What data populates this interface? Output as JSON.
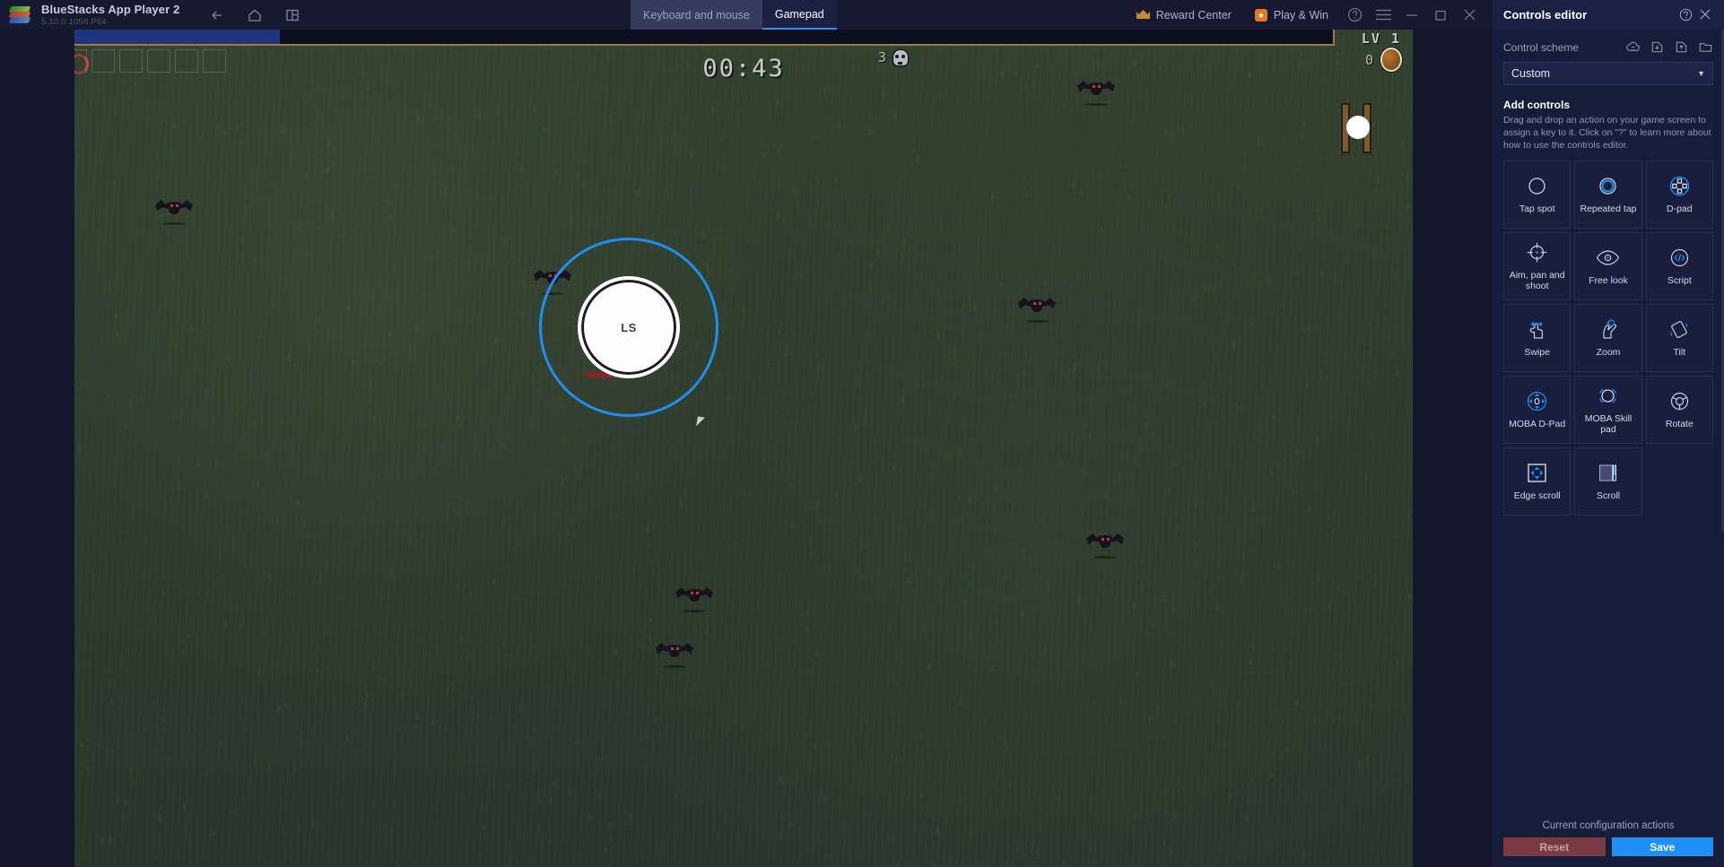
{
  "titlebar": {
    "app_name": "BlueStacks App Player 2",
    "app_version": "5.10.0.1058  P64",
    "nav": [
      {
        "name": "back-icon",
        "label": "Back"
      },
      {
        "name": "home-icon",
        "label": "Home"
      },
      {
        "name": "multi-instance-icon",
        "label": "Multi-instance"
      }
    ],
    "tabs": [
      {
        "label": "Keyboard and mouse",
        "active": false
      },
      {
        "label": "Gamepad",
        "active": true
      }
    ],
    "reward_center": "Reward Center",
    "play_and_win": "Play & Win",
    "window_controls": [
      "help-icon",
      "menu-icon",
      "minimize-icon",
      "maximize-icon",
      "close-icon"
    ]
  },
  "game": {
    "level_label": "LV 1",
    "xp_percent": 17,
    "timer": "00:43",
    "kill_count": "3",
    "coin_count": "0",
    "joystick_label": "LS",
    "item_slots": 6,
    "filled_slots": 1
  },
  "panel": {
    "title": "Controls editor",
    "help_icon": "help-icon",
    "close_icon": "close-icon",
    "scheme_label": "Control scheme",
    "scheme_icons": [
      {
        "name": "cloud-sync-icon"
      },
      {
        "name": "import-scheme-icon"
      },
      {
        "name": "export-scheme-icon"
      },
      {
        "name": "open-folder-icon"
      }
    ],
    "scheme_value": "Custom",
    "add_controls_title": "Add controls",
    "add_controls_desc": "Drag and drop an action on your game screen to assign a key to it. Click on \"?\" to learn more about how to use the controls editor.",
    "controls": [
      {
        "label": "Tap spot",
        "icon": "tap-spot-icon"
      },
      {
        "label": "Repeated tap",
        "icon": "repeated-tap-icon"
      },
      {
        "label": "D-pad",
        "icon": "d-pad-icon"
      },
      {
        "label": "Aim, pan and shoot",
        "icon": "aim-pan-shoot-icon"
      },
      {
        "label": "Free look",
        "icon": "free-look-icon"
      },
      {
        "label": "Script",
        "icon": "script-icon"
      },
      {
        "label": "Swipe",
        "icon": "swipe-icon"
      },
      {
        "label": "Zoom",
        "icon": "zoom-icon"
      },
      {
        "label": "Tilt",
        "icon": "tilt-icon"
      },
      {
        "label": "MOBA D-Pad",
        "icon": "moba-dpad-icon"
      },
      {
        "label": "MOBA Skill pad",
        "icon": "moba-skill-pad-icon"
      },
      {
        "label": "Rotate",
        "icon": "rotate-icon"
      },
      {
        "label": "Edge scroll",
        "icon": "edge-scroll-icon"
      },
      {
        "label": "Scroll",
        "icon": "scroll-icon"
      }
    ],
    "footer_caption": "Current configuration actions",
    "reset_label": "Reset",
    "save_label": "Save"
  },
  "colors": {
    "accent": "#1f8ff5",
    "panel_bg": "#171c38",
    "titlebar_bg": "#161a31",
    "reset_bg": "#7a3a42",
    "xp_fill": "#1f357f",
    "xp_border": "#9c7b45"
  }
}
